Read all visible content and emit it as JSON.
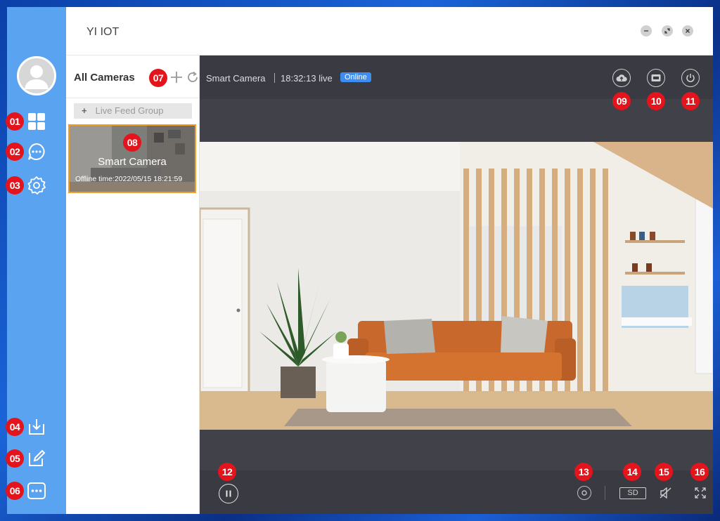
{
  "app": {
    "title": "YI IOT"
  },
  "sidebar": {
    "badges": [
      "01",
      "02",
      "03",
      "04",
      "05",
      "06"
    ],
    "icons": [
      "grid-icon",
      "chat-icon",
      "settings-icon",
      "download-icon",
      "edit-icon",
      "more-icon"
    ]
  },
  "panel": {
    "title": "All Cameras",
    "badge": "07",
    "group_label": "Live Feed Group",
    "camera": {
      "badge": "08",
      "name": "Smart Camera",
      "offline": "Offline time:2022/05/15 18:21:59"
    }
  },
  "viewer": {
    "camera_name": "Smart Camera",
    "time": "18:32:13 live",
    "status": "Online",
    "top_badges": [
      "09",
      "10",
      "11"
    ],
    "bottom_badges": [
      "12",
      "13",
      "14",
      "15",
      "16"
    ],
    "quality": "SD"
  },
  "colors": {
    "sidebar": "#5aa3f0",
    "badge": "#e3141b",
    "online": "#3d8ef0",
    "selected": "#f0a028"
  }
}
